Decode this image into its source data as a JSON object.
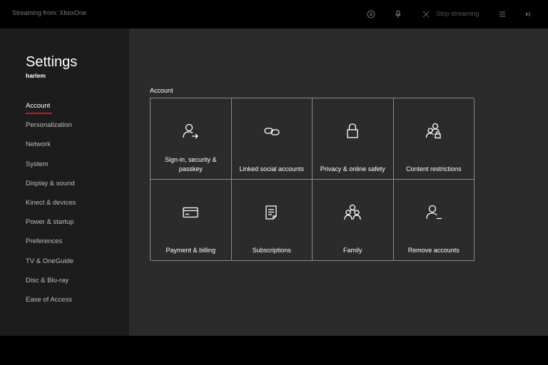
{
  "topbar": {
    "stream_title": "Streaming from: XboxOne",
    "stop_label": "Stop streaming",
    "icons": [
      "xbox-icon",
      "microphone-icon",
      "stop-icon",
      "menu-icon",
      "next-icon"
    ]
  },
  "sidebar": {
    "title": "Settings",
    "user": "harlem",
    "items": [
      {
        "label": "Account"
      },
      {
        "label": "Personalization"
      },
      {
        "label": "Network"
      },
      {
        "label": "System"
      },
      {
        "label": "Display & sound"
      },
      {
        "label": "Kinect & devices"
      },
      {
        "label": "Power & startup"
      },
      {
        "label": "Preferences"
      },
      {
        "label": "TV & OneGuide"
      },
      {
        "label": "Disc & Blu-ray"
      },
      {
        "label": "Ease of Access"
      }
    ],
    "active_index": 0
  },
  "main": {
    "section_title": "Account",
    "tiles": [
      {
        "label": "Sign-in, security & passkey",
        "icon": "person-arrow-icon"
      },
      {
        "label": "Linked social accounts",
        "icon": "link-icon"
      },
      {
        "label": "Privacy & online safety",
        "icon": "lock-icon"
      },
      {
        "label": "Content restrictions",
        "icon": "people-lock-icon"
      },
      {
        "label": "Payment & billing",
        "icon": "credit-card-icon"
      },
      {
        "label": "Subscriptions",
        "icon": "document-icon"
      },
      {
        "label": "Family",
        "icon": "family-icon"
      },
      {
        "label": "Remove accounts",
        "icon": "person-remove-icon"
      }
    ]
  },
  "colors": {
    "accent": "#d4141d",
    "sidebar_bg": "#1c1c1c",
    "main_bg": "#2b2b2b",
    "tile_border": "#8a8a8a"
  }
}
